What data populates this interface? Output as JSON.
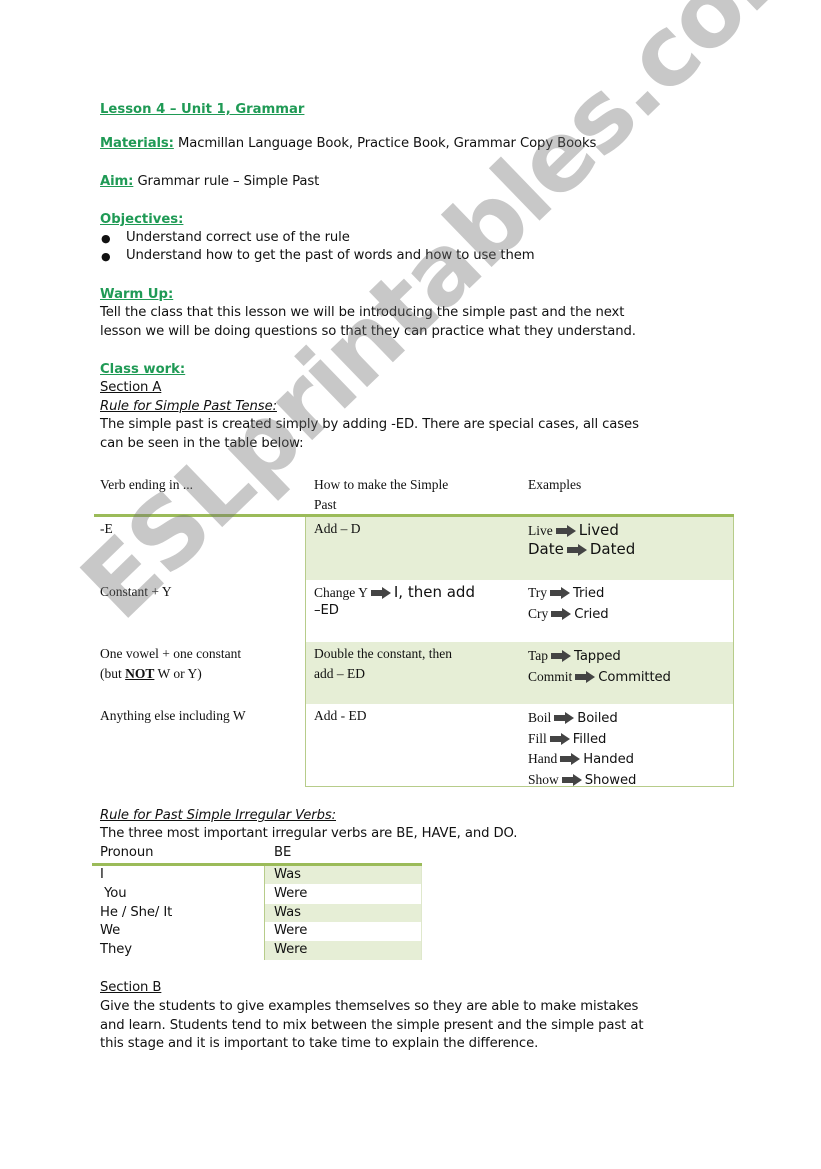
{
  "title": "Lesson 4 – Unit 1, Grammar",
  "materials": {
    "label": "Materials:",
    "value": "Macmillan Language Book, Practice Book, Grammar Copy Books"
  },
  "aim": {
    "label": "Aim:",
    "value": "Grammar rule – Simple Past"
  },
  "objectives": {
    "label": "Objectives:",
    "items": [
      "Understand correct use of the rule",
      "Understand how to get the past of words and how to use them"
    ]
  },
  "warm_up": {
    "label": "Warm Up:",
    "lines": [
      "Tell the class that this lesson we will be introducing the simple past and the next",
      "lesson we will be doing questions so that they can practice what they understand."
    ]
  },
  "class_work": {
    "label": "Class work:",
    "section_a": "Section A",
    "rule_heading": "Rule for Simple Past Tense:",
    "rule_lines": [
      "The simple past is created simply by adding -ED. There are special cases, all cases",
      "can be seen in the table below:"
    ]
  },
  "past_table": {
    "headers": [
      "Verb ending in ...",
      "How to make the Simple",
      "Past",
      "Examples"
    ],
    "rows": [
      {
        "ending": [
          "-E"
        ],
        "how": [
          "Add – D"
        ],
        "examples": [
          [
            "Live",
            "Lived"
          ],
          [
            "Date",
            "Dated"
          ]
        ]
      },
      {
        "ending": [
          "Constant + Y"
        ],
        "how_pre": "Change Y",
        "how_post": "I, then add",
        "how_line2": "–ED",
        "examples": [
          [
            "Try",
            "Tried"
          ],
          [
            "Cry",
            "Cried"
          ]
        ]
      },
      {
        "ending": [
          "One vowel + one constant",
          "(but ",
          "NOT",
          " W or Y)"
        ],
        "how": [
          "Double the constant, then",
          "add – ED"
        ],
        "examples": [
          [
            "Tap",
            "Tapped"
          ],
          [
            "Commit",
            "Committed"
          ]
        ]
      },
      {
        "ending": [
          "Anything else including W"
        ],
        "how": [
          "Add - ED"
        ],
        "examples": [
          [
            "Boil",
            "Boiled"
          ],
          [
            "Fill",
            "Filled"
          ],
          [
            "Hand",
            "Handed"
          ],
          [
            "Show",
            "Showed"
          ]
        ]
      }
    ]
  },
  "irregular": {
    "heading": "Rule for Past Simple Irregular Verbs:",
    "intro": "The three most important irregular verbs are BE, HAVE, and DO.",
    "headers": [
      "Pronoun",
      "BE"
    ],
    "rows": [
      [
        "I",
        "Was"
      ],
      [
        " You",
        "Were"
      ],
      [
        "He / She/ It",
        "Was"
      ],
      [
        "We",
        "Were"
      ],
      [
        "They",
        "Were"
      ]
    ]
  },
  "section_b": {
    "label": "Section B",
    "lines": [
      "Give the students to give examples themselves so they are able to make mistakes",
      "and learn. Students tend to mix between the simple present and the simple past at",
      "this stage and it is important to take time to explain the difference."
    ]
  },
  "watermark": "ESLprintables.com",
  "colors": {
    "heading_green": "#1f9a55",
    "table_band": "#e6eed6",
    "table_rule": "#9bbb59"
  }
}
